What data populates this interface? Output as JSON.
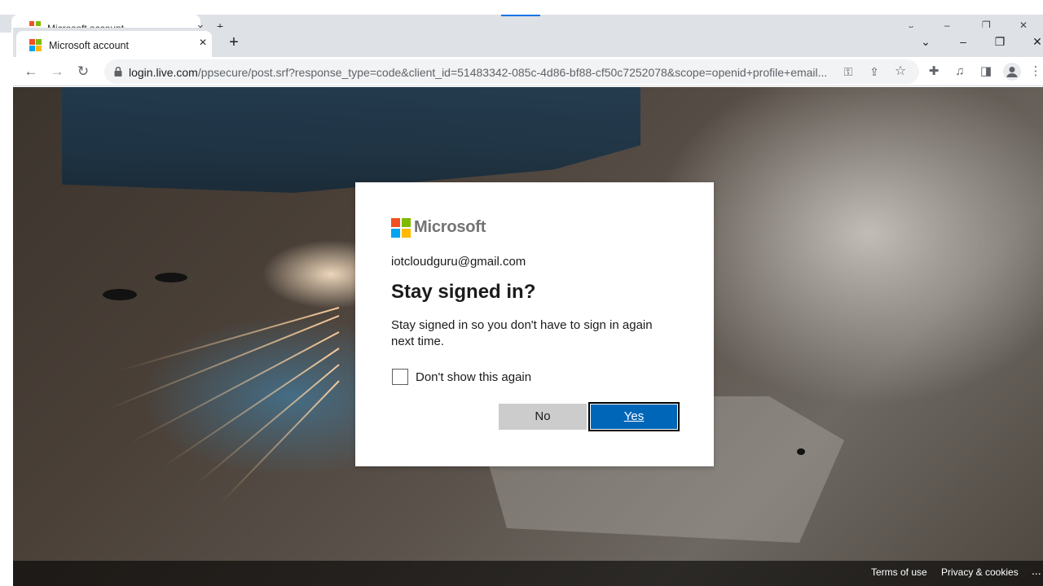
{
  "ghost_tab": {
    "title": "Microsoft account",
    "close": "×",
    "new_tab": "+",
    "window_controls": [
      "⌄",
      "–",
      "❐",
      "✕"
    ]
  },
  "browser": {
    "tab_title": "Microsoft account",
    "tab_close": "×",
    "new_tab": "+",
    "window_controls": {
      "tab_search": "⌄",
      "minimize": "–",
      "restore": "❐",
      "close": "✕"
    },
    "nav": {
      "back": "←",
      "forward": "→",
      "reload": "↻"
    },
    "url_host": "login.live.com",
    "url_path": "/ppsecure/post.srf?response_type=code&client_id=51483342-085c-4d86-bf88-cf50c7252078&scope=openid+profile+email...",
    "omni_icons": {
      "key": "⚿",
      "share": "⇪",
      "star": "☆"
    },
    "toolbar_icons": {
      "extensions": "✚",
      "media": "♫",
      "side_panel": "◨",
      "menu": "⋮"
    }
  },
  "dialog": {
    "brand": "Microsoft",
    "brand_colors": [
      "#f25022",
      "#7fba00",
      "#00a4ef",
      "#ffb900"
    ],
    "email": "iotcloudguru@gmail.com",
    "heading": "Stay signed in?",
    "description": "Stay signed in so you don't have to sign in again next time.",
    "checkbox_label": "Don't show this again",
    "checkbox_checked": false,
    "no_label": "No",
    "yes_label": "Yes",
    "accent": "#0067b8"
  },
  "footer": {
    "terms": "Terms of use",
    "privacy": "Privacy & cookies",
    "more": "..."
  }
}
